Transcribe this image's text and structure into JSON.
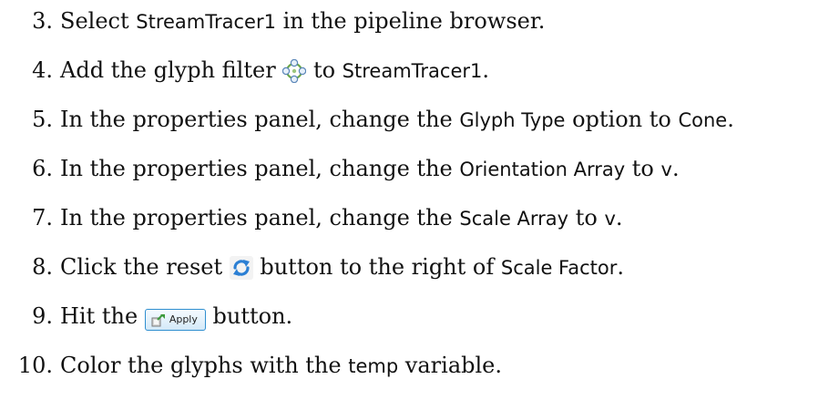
{
  "steps": [
    {
      "num": "3.",
      "parts": [
        "Select ",
        "StreamTracer1",
        " in the pipeline browser."
      ]
    },
    {
      "num": "4.",
      "parts": [
        "Add the glyph filter ",
        " to ",
        "StreamTracer1",
        "."
      ]
    },
    {
      "num": "5.",
      "parts": [
        "In the properties panel, change the ",
        "Glyph Type",
        " option to ",
        "Cone",
        "."
      ]
    },
    {
      "num": "6.",
      "parts": [
        "In the properties panel, change the ",
        "Orientation Array",
        " to ",
        "v",
        "."
      ]
    },
    {
      "num": "7.",
      "parts": [
        "In the properties panel, change the ",
        "Scale Array",
        " to ",
        "v",
        "."
      ]
    },
    {
      "num": "8.",
      "parts": [
        "Click the reset ",
        " button to the right of ",
        "Scale Factor",
        "."
      ]
    },
    {
      "num": "9.",
      "parts": [
        "Hit the ",
        " button."
      ]
    },
    {
      "num": "10.",
      "parts": [
        "Color the glyphs with the ",
        "temp",
        " variable."
      ]
    }
  ],
  "apply_button_label": "Apply",
  "icons": {
    "glyph_filter": "glyph-filter-icon",
    "reset": "reset-icon",
    "apply": "apply-icon"
  }
}
